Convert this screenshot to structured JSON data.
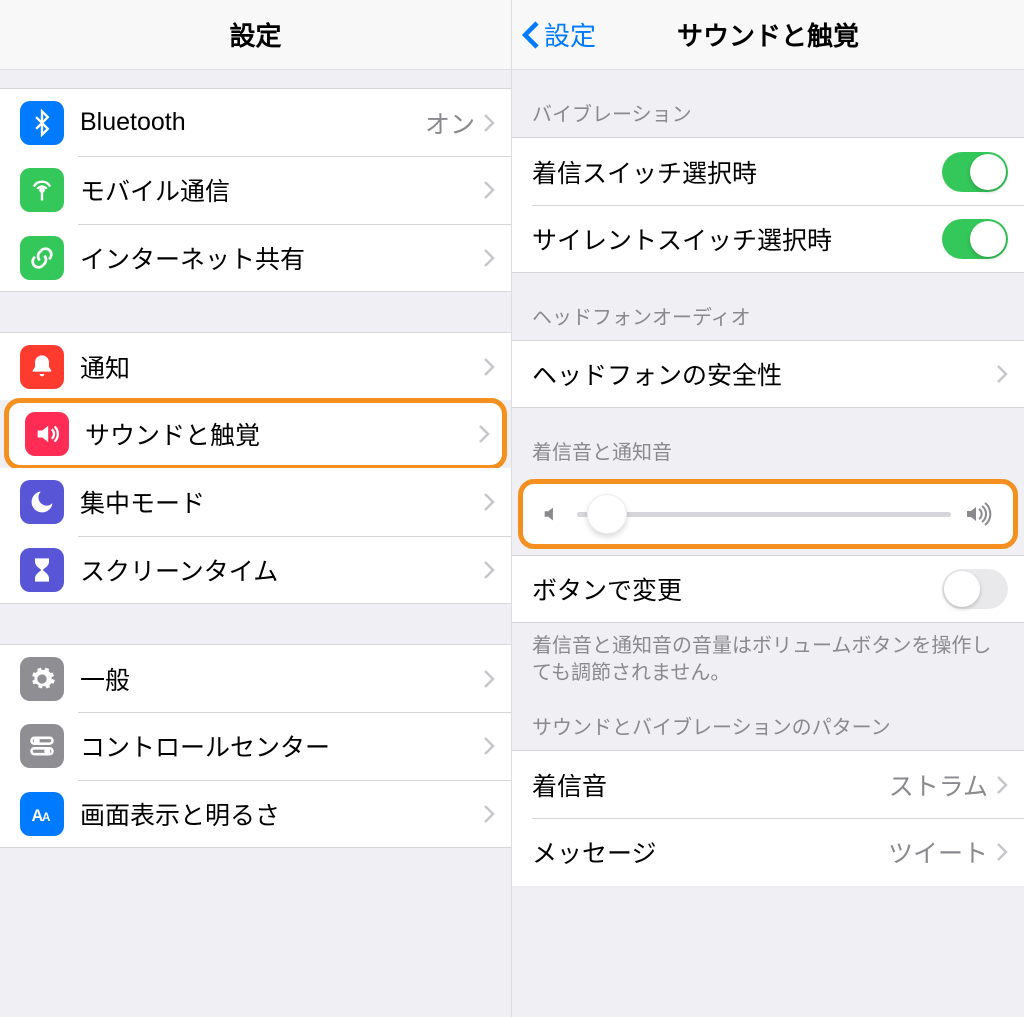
{
  "left": {
    "title": "設定",
    "groups": [
      {
        "items": [
          {
            "id": "bluetooth",
            "label": "Bluetooth",
            "detail": "オン",
            "icon": "bluetooth",
            "color": "ic-blue"
          },
          {
            "id": "cellular",
            "label": "モバイル通信",
            "icon": "antenna",
            "color": "ic-green"
          },
          {
            "id": "hotspot",
            "label": "インターネット共有",
            "icon": "link",
            "color": "ic-green"
          }
        ]
      },
      {
        "items": [
          {
            "id": "notifications",
            "label": "通知",
            "icon": "bell",
            "color": "ic-red"
          },
          {
            "id": "sounds",
            "label": "サウンドと触覚",
            "icon": "speaker",
            "color": "ic-pink",
            "highlighted": true
          },
          {
            "id": "focus",
            "label": "集中モード",
            "icon": "moon",
            "color": "ic-indigo"
          },
          {
            "id": "screentime",
            "label": "スクリーンタイム",
            "icon": "hourglass",
            "color": "ic-indigo"
          }
        ]
      },
      {
        "items": [
          {
            "id": "general",
            "label": "一般",
            "icon": "gear",
            "color": "ic-gray"
          },
          {
            "id": "controlcenter",
            "label": "コントロールセンター",
            "icon": "switches",
            "color": "ic-gray"
          },
          {
            "id": "display",
            "label": "画面表示と明るさ",
            "icon": "aa",
            "color": "ic-blue"
          }
        ]
      }
    ]
  },
  "right": {
    "back": "設定",
    "title": "サウンドと触覚",
    "section_vibrate_header": "バイブレーション",
    "vibrate_ring_label": "着信スイッチ選択時",
    "vibrate_ring_on": true,
    "vibrate_silent_label": "サイレントスイッチ選択時",
    "vibrate_silent_on": true,
    "section_headphone_header": "ヘッドフォンオーディオ",
    "headphone_safety_label": "ヘッドフォンの安全性",
    "section_ringer_header": "着信音と通知音",
    "slider_value_percent": 8,
    "change_with_buttons_label": "ボタンで変更",
    "change_with_buttons_on": false,
    "ringer_footer": "着信音と通知音の音量はボリュームボタンを操作しても調節されません。",
    "section_patterns_header": "サウンドとバイブレーションのパターン",
    "ringtone_label": "着信音",
    "ringtone_value": "ストラム",
    "text_tone_label": "メッセージ",
    "text_tone_value": "ツイート"
  }
}
